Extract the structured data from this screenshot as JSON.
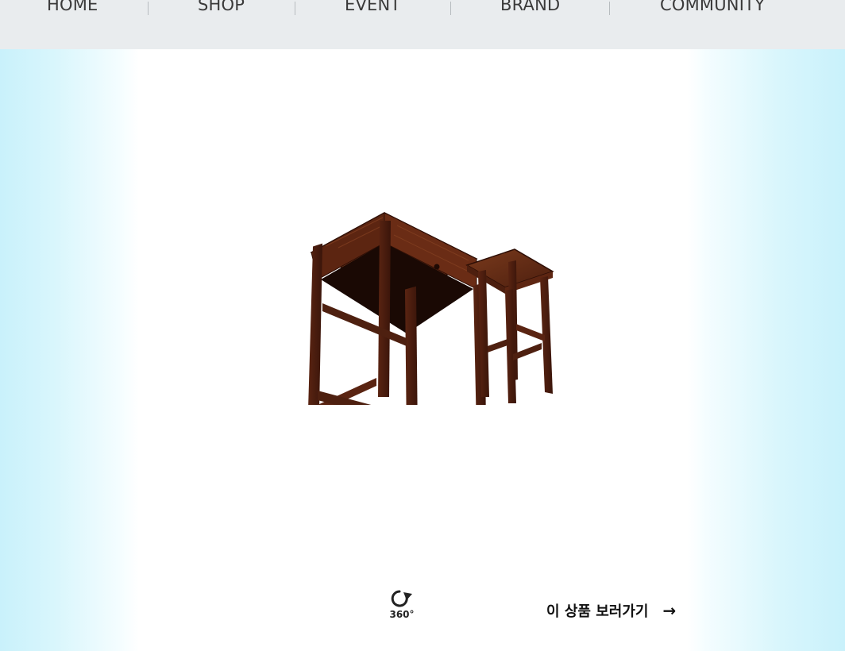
{
  "nav": {
    "items": [
      {
        "label": "HOME"
      },
      {
        "label": "SHOP"
      },
      {
        "label": "EVENT"
      },
      {
        "label": "BRAND"
      },
      {
        "label": "COMMUNITY"
      }
    ]
  },
  "viewer": {
    "rotate_label": "360°",
    "rotate_icon": "rotate-360-icon"
  },
  "cta": {
    "label": "이 상품 보러가기",
    "arrow": "→",
    "arrow_icon": "arrow-right-icon"
  },
  "colors": {
    "nav_bg": "#e9ecee",
    "nav_text": "#3a3a3a",
    "edge_gradient": "#c9f1fb",
    "wood_dark": "#4a1e10",
    "wood_mid": "#6b2f18"
  }
}
